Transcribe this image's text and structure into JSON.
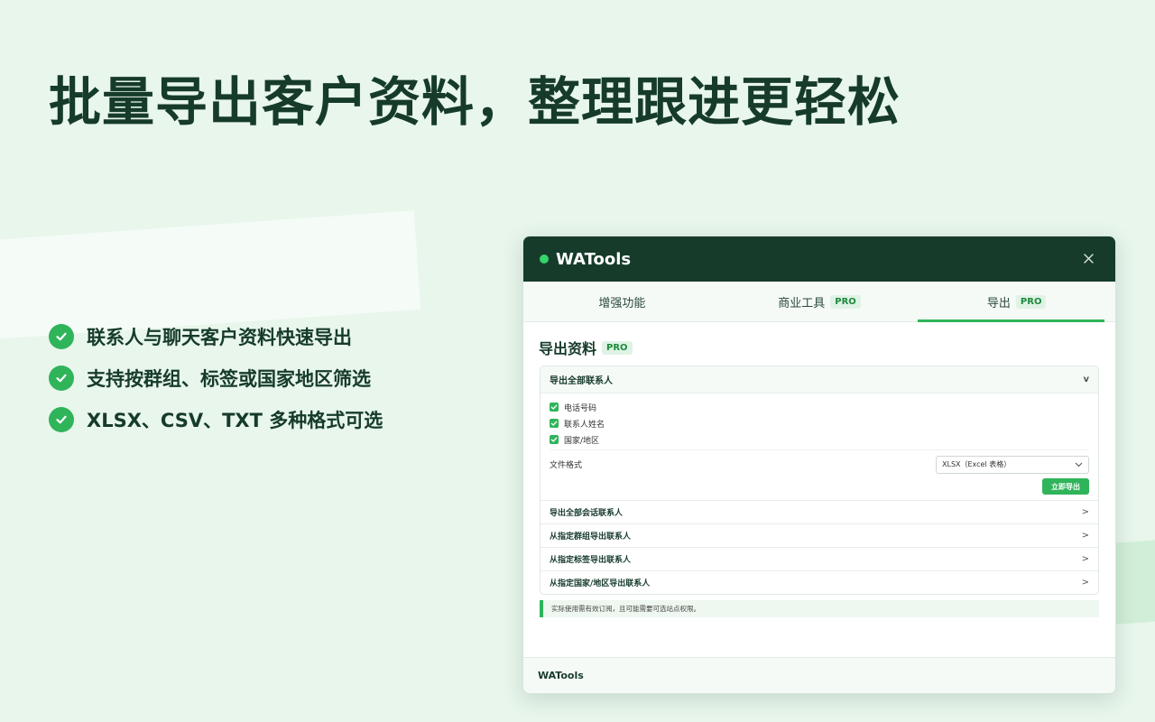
{
  "headline": "批量导出客户资料，整理跟进更轻松",
  "features": [
    "联系人与聊天客户资料快速导出",
    "支持按群组、标签或国家地区筛选",
    "XLSX、CSV、TXT 多种格式可选"
  ],
  "panel": {
    "title": "WATools",
    "tabs": [
      {
        "label": "增强功能",
        "badge": ""
      },
      {
        "label": "商业工具",
        "badge": "PRO"
      },
      {
        "label": "导出",
        "badge": "PRO"
      }
    ],
    "section_title": "导出资料",
    "section_badge": "PRO",
    "accordion": {
      "head": "导出全部联系人",
      "chevron": "v",
      "checkboxes": [
        "电话号码",
        "联系人姓名",
        "国家/地区"
      ],
      "format_label": "文件格式",
      "format_value": "XLSX（Excel 表格）",
      "export_button": "立即导出",
      "items": [
        "导出全部会话联系人",
        "从指定群组导出联系人",
        "从指定标签导出联系人",
        "从指定国家/地区导出联系人"
      ],
      "item_arrow": ">"
    },
    "note": "实际使用需有效订阅，且可能需要可选站点权限。",
    "footer": "WATools"
  },
  "colors": {
    "background": "#e8f6ec",
    "header": "#163b2b",
    "accent": "#2fb45a"
  }
}
